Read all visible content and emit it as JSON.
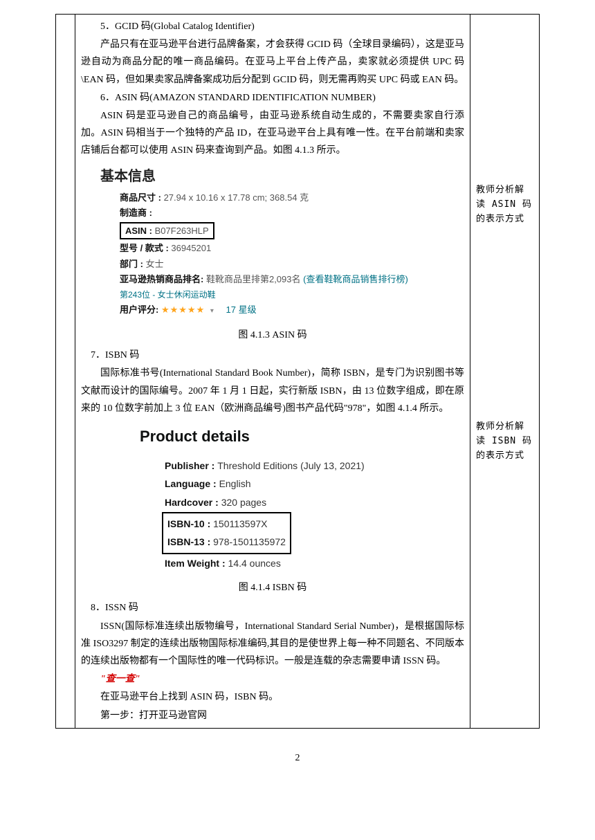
{
  "main": {
    "gcid_heading": "5．GCID 码(Global Catalog Identifier)",
    "gcid_p1": "产品只有在亚马逊平台进行品牌备案，才会获得 GCID 码（全球目录编码），这是亚马逊自动为商品分配的唯一商品编码。在亚马上平台上传产品，卖家就必须提供 UPC 码\\EAN 码，但如果卖家品牌备案成功后分配到 GCID 码，则无需再购买 UPC 码或 EAN 码。",
    "asin_heading": "6．ASIN 码(AMAZON STANDARD IDENTIFICATION NUMBER)",
    "asin_p1": "ASIN 码是亚马逊自己的商品编号，由亚马逊系统自动生成的，不需要卖家自行添加。ASIN 码相当于一个独特的产品 ID，在亚马逊平台上具有唯一性。在平台前端和卖家店铺后台都可以使用 ASIN 码来查询到产品。如图 4.1.3 所示。",
    "fig413": "图 4.1.3   ASIN 码",
    "isbn_heading": "7．ISBN 码",
    "isbn_p1": "国际标准书号(International Standard Book Number)，简称 ISBN，是专门为识别图书等文献而设计的国际编号。2007 年 1 月 1 日起，实行新版 ISBN，由 13 位数字组成，即在原来的 10 位数字前加上 3 位 EAN（欧洲商品编号)图书产品代码\"978\"，如图 4.1.4 所示。",
    "fig414": "图 4.1.4   ISBN 码",
    "issn_heading": "8．ISSN 码",
    "issn_p1": "ISSN(国际标准连续出版物编号，International Standard Serial Number)，是根据国际标准 ISO3297 制定的连续出版物国际标准编码,其目的是使世界上每一种不同题名、不同版本的连续出版物都有一个国际性的唯一代码标识。一般是连载的杂志需要申请 ISSN 码。",
    "check_heading": "\"查一查\"",
    "check_l1": "在亚马逊平台上找到 ASIN 码，ISBN 码。",
    "check_l2": "第一步：打开亚马逊官网"
  },
  "basicInfo": {
    "title": "基本信息",
    "dim_label": "商品尺寸 :",
    "dim_value": "27.94 x 10.16 x 17.78 cm; 368.54 克",
    "mfr_label": "制造商 :",
    "asin_label": "ASIN :",
    "asin_value": "B07F263HLP",
    "model_label": "型号 / 款式 :",
    "model_value": "36945201",
    "dept_label": "部门 :",
    "dept_value": "女士",
    "rank_label": "亚马逊热销商品排名:",
    "rank_text": " 鞋靴商品里排第2,093名 ",
    "rank_link": "(查看鞋靴商品销售排行榜)",
    "rank_sub": "第243位 - 女士休闲运动鞋",
    "rating_label": "用户评分:",
    "stars": "★★★★★",
    "star_text": "17 星级"
  },
  "productDetails": {
    "title": "Product details",
    "publisher_k": "Publisher  : ",
    "publisher_v": "Threshold Editions (July 13, 2021)",
    "language_k": "Language  : ",
    "language_v": "English",
    "hardcover_k": "Hardcover  : ",
    "hardcover_v": "320 pages",
    "isbn10_k": "ISBN-10  : ",
    "isbn10_v": "150113597X",
    "isbn13_k": "ISBN-13  : ",
    "isbn13_v": "978-1501135972",
    "weight_k": "Item Weight  : ",
    "weight_v": "14.4 ounces"
  },
  "annotation": {
    "note1": "教师分析解读 ASIN 码的表示方式",
    "note2": "教师分析解读 ISBN 码的表示方式"
  },
  "page_number": "2"
}
